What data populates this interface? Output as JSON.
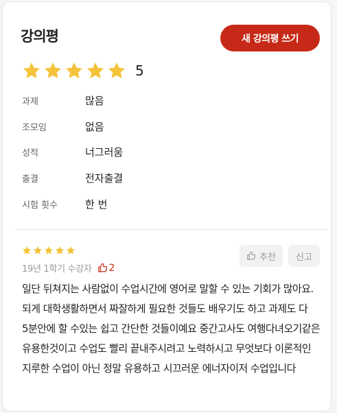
{
  "header": {
    "title": "강의평",
    "write_button_label": "새 강의평 쓰기"
  },
  "summary": {
    "rating": 5,
    "rating_label": "5",
    "max_stars": 5
  },
  "attributes": [
    {
      "key": "과제",
      "value": "많음"
    },
    {
      "key": "조모임",
      "value": "없음"
    },
    {
      "key": "성적",
      "value": "너그러움"
    },
    {
      "key": "출결",
      "value": "전자출결"
    },
    {
      "key": "시험 횟수",
      "value": "한 번"
    }
  ],
  "review": {
    "stars": 5,
    "meta": "19년 1학기 수강자",
    "likes": "2",
    "recommend_label": "추천",
    "report_label": "신고",
    "text": "일단 뒤쳐지는 사람없이 수업시간에 영어로 말할 수 있는 기회가 많아요. 되게 대학생활하면서 짜잘하게 필요한 것들도 배우기도 하고 과제도 다 5분안에 할 수있는 쉽고 간단한 것들이예요 중간고사도 여행다녀오기같은 유용한것이고 수업도 빨리 끝내주시려고 노력하시고 무엇보다 이론적인 지루한 수업이 아닌 정말 유용하고 시끄러운 에너자이저 수업입니다"
  },
  "colors": {
    "accent": "#c62917",
    "star": "#f5c33b"
  }
}
